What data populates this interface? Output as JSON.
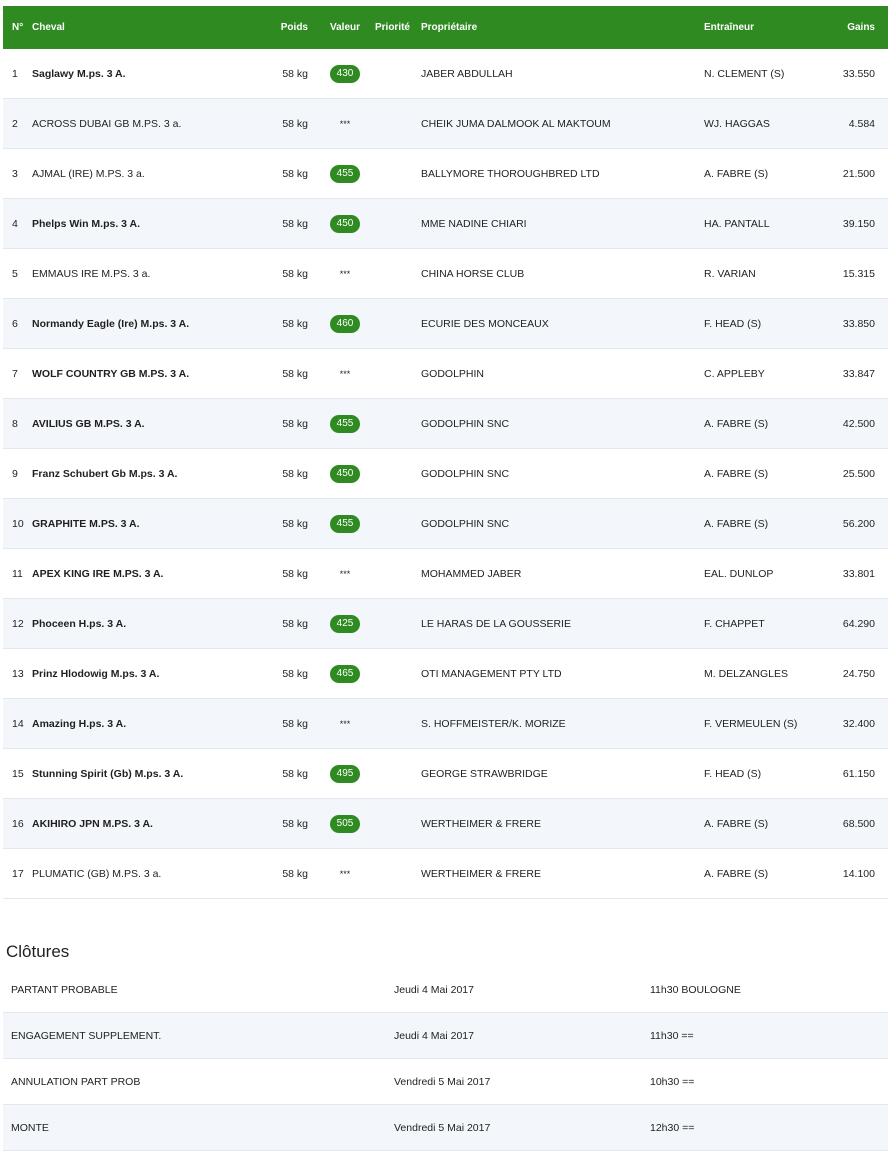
{
  "table": {
    "headers": {
      "num": "N°",
      "horse": "Cheval",
      "weight": "Poids",
      "rating": "Valeur",
      "priority": "Priorité",
      "owner": "Propriétaire",
      "trainer": "Entraîneur",
      "gains": "Gains"
    },
    "rows": [
      {
        "num": "1",
        "horse": "Saglawy M.ps. 3 A.",
        "bold": true,
        "weight": "58 kg",
        "rating": "430",
        "owner": "JABER ABDULLAH",
        "trainer": "N. CLEMENT (S)",
        "gains": "33.550"
      },
      {
        "num": "2",
        "horse": "ACROSS DUBAI GB M.PS. 3 a.",
        "bold": false,
        "weight": "58 kg",
        "rating": "***",
        "owner": "CHEIK JUMA DALMOOK AL MAKTOUM",
        "trainer": "WJ. HAGGAS",
        "gains": "4.584"
      },
      {
        "num": "3",
        "horse": "AJMAL (IRE) M.PS. 3 a.",
        "bold": false,
        "weight": "58 kg",
        "rating": "455",
        "owner": "BALLYMORE THOROUGHBRED LTD",
        "trainer": "A. FABRE (S)",
        "gains": "21.500"
      },
      {
        "num": "4",
        "horse": "Phelps Win M.ps. 3 A.",
        "bold": true,
        "weight": "58 kg",
        "rating": "450",
        "owner": "MME NADINE CHIARI",
        "trainer": "HA. PANTALL",
        "gains": "39.150"
      },
      {
        "num": "5",
        "horse": "EMMAUS IRE M.PS. 3 a.",
        "bold": false,
        "weight": "58 kg",
        "rating": "***",
        "owner": "CHINA HORSE CLUB",
        "trainer": "R. VARIAN",
        "gains": "15.315"
      },
      {
        "num": "6",
        "horse": "Normandy Eagle (Ire) M.ps. 3 A.",
        "bold": true,
        "weight": "58 kg",
        "rating": "460",
        "owner": "ECURIE DES MONCEAUX",
        "trainer": "F. HEAD (S)",
        "gains": "33.850"
      },
      {
        "num": "7",
        "horse": "WOLF COUNTRY GB M.PS. 3 A.",
        "bold": true,
        "weight": "58 kg",
        "rating": "***",
        "owner": "GODOLPHIN",
        "trainer": "C. APPLEBY",
        "gains": "33.847"
      },
      {
        "num": "8",
        "horse": "AVILIUS GB M.PS. 3 A.",
        "bold": true,
        "weight": "58 kg",
        "rating": "455",
        "owner": "GODOLPHIN SNC",
        "trainer": "A. FABRE (S)",
        "gains": "42.500"
      },
      {
        "num": "9",
        "horse": "Franz Schubert Gb M.ps. 3 A.",
        "bold": true,
        "weight": "58 kg",
        "rating": "450",
        "owner": "GODOLPHIN SNC",
        "trainer": "A. FABRE (S)",
        "gains": "25.500"
      },
      {
        "num": "10",
        "horse": "GRAPHITE M.PS. 3 A.",
        "bold": true,
        "weight": "58 kg",
        "rating": "455",
        "owner": "GODOLPHIN SNC",
        "trainer": "A. FABRE (S)",
        "gains": "56.200"
      },
      {
        "num": "11",
        "horse": "APEX KING IRE M.PS. 3 A.",
        "bold": true,
        "weight": "58 kg",
        "rating": "***",
        "owner": "MOHAMMED JABER",
        "trainer": "EAL. DUNLOP",
        "gains": "33.801"
      },
      {
        "num": "12",
        "horse": "Phoceen H.ps. 3 A.",
        "bold": true,
        "weight": "58 kg",
        "rating": "425",
        "owner": "LE HARAS DE LA GOUSSERIE",
        "trainer": "F. CHAPPET",
        "gains": "64.290"
      },
      {
        "num": "13",
        "horse": "Prinz Hlodowig M.ps. 3 A.",
        "bold": true,
        "weight": "58 kg",
        "rating": "465",
        "owner": "OTI MANAGEMENT PTY LTD",
        "trainer": "M. DELZANGLES",
        "gains": "24.750"
      },
      {
        "num": "14",
        "horse": "Amazing H.ps. 3 A.",
        "bold": true,
        "weight": "58 kg",
        "rating": "***",
        "owner": "S. HOFFMEISTER/K. MORIZE",
        "trainer": "F. VERMEULEN (S)",
        "gains": "32.400"
      },
      {
        "num": "15",
        "horse": "Stunning Spirit (Gb) M.ps. 3 A.",
        "bold": true,
        "weight": "58 kg",
        "rating": "495",
        "owner": "GEORGE STRAWBRIDGE",
        "trainer": "F. HEAD (S)",
        "gains": "61.150"
      },
      {
        "num": "16",
        "horse": "AKIHIRO JPN M.PS. 3 A.",
        "bold": true,
        "weight": "58 kg",
        "rating": "505",
        "owner": "WERTHEIMER & FRERE",
        "trainer": "A. FABRE (S)",
        "gains": "68.500"
      },
      {
        "num": "17",
        "horse": "PLUMATIC (GB) M.PS. 3 a.",
        "bold": false,
        "weight": "58 kg",
        "rating": "***",
        "owner": "WERTHEIMER & FRERE",
        "trainer": "A. FABRE (S)",
        "gains": "14.100"
      }
    ]
  },
  "closures": {
    "title": "Clôtures",
    "rows": [
      {
        "label": "PARTANT PROBABLE",
        "date": "Jeudi 4 Mai 2017",
        "time": "11h30 BOULOGNE"
      },
      {
        "label": "ENGAGEMENT SUPPLEMENT.",
        "date": "Jeudi 4 Mai 2017",
        "time": "11h30 =="
      },
      {
        "label": "ANNULATION PART PROB",
        "date": "Vendredi 5 Mai 2017",
        "time": "10h30 =="
      },
      {
        "label": "MONTE",
        "date": "Vendredi 5 Mai 2017",
        "time": "12h30 =="
      }
    ]
  },
  "colors": {
    "header_bg": "#2f8a22",
    "badge_bg": "#2f8a22",
    "link_underline": "#f0a33c",
    "row_alt_bg": "#f3f7fb"
  }
}
